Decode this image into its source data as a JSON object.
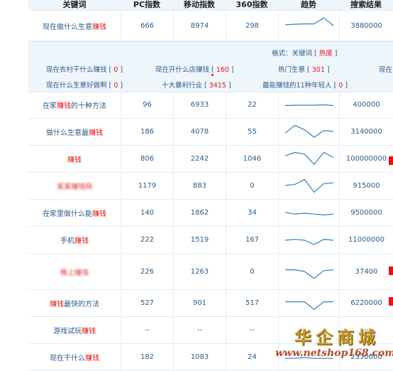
{
  "header": {
    "keyword": "关键词",
    "pc": "PC指数",
    "mobile": "移动指数",
    "s360": "360指数",
    "trend": "趋势",
    "results": "搜索结果"
  },
  "top_row": {
    "kw_pre": "现在做什么生意",
    "kw_hl": "赚钱",
    "kw_post": "",
    "pc": "666",
    "mobile": "8974",
    "s360": "298",
    "results": "3880000"
  },
  "related": {
    "format_label": "格式：关键词 [ ",
    "format_hot": "热度",
    "format_end": " ]",
    "items": [
      {
        "text": "现在农村干什么赚钱 [ ",
        "num": "0",
        "end": " ]"
      },
      {
        "text": "现在开什么店赚钱 [ ",
        "num": "160",
        "end": " ]"
      },
      {
        "text": "热门生意 [ ",
        "num": "301",
        "end": " ]"
      },
      {
        "text": "现在",
        "num": "",
        "end": ""
      },
      {
        "text": "现在什么生意好做啊 [ ",
        "num": "0",
        "end": " ]"
      },
      {
        "text": "十大暴利行业 [ ",
        "num": "3415",
        "end": " ]"
      },
      {
        "text": "最能赚钱的11种年轻人 [ ",
        "num": "0",
        "end": " ]"
      }
    ]
  },
  "rows": [
    {
      "pre": "在家",
      "hl": "赚钱",
      "post": "的十种方法",
      "pc": "96",
      "mobile": "6933",
      "s360": "22",
      "results": "400000"
    },
    {
      "pre": "做什么生意最",
      "hl": "赚钱",
      "post": "",
      "pc": "186",
      "mobile": "4078",
      "s360": "55",
      "results": "3140000"
    },
    {
      "pre": "",
      "hl": "赚钱",
      "post": "",
      "pc": "806",
      "mobile": "2242",
      "s360": "1046",
      "results": "100000000"
    },
    {
      "pre": "",
      "hl": "",
      "post": "",
      "blur": "某某赚钱网",
      "pc": "1179",
      "mobile": "883",
      "s360": "0",
      "results": "915000"
    },
    {
      "pre": "在家里做什么能",
      "hl": "赚钱",
      "post": "",
      "pc": "140",
      "mobile": "1862",
      "s360": "34",
      "results": "9500000"
    },
    {
      "pre": "手机",
      "hl": "赚钱",
      "post": "",
      "pc": "222",
      "mobile": "1519",
      "s360": "167",
      "results": "11000000"
    },
    {
      "pre": "",
      "hl": "",
      "post": "",
      "blur": "晚上赚钱",
      "pc": "226",
      "mobile": "1263",
      "s360": "0",
      "results": "37400"
    },
    {
      "pre": "",
      "hl": "赚钱",
      "post": "最快的方法",
      "pc": "527",
      "mobile": "901",
      "s360": "517",
      "results": "6220000"
    },
    {
      "pre": "游戏试玩",
      "hl": "赚钱",
      "post": "",
      "pc": "--",
      "mobile": "--",
      "s360": "--",
      "results": "--"
    },
    {
      "pre": "现在干什么",
      "hl": "赚钱",
      "post": "",
      "pc": "182",
      "mobile": "1083",
      "s360": "24",
      "results": "2330000"
    }
  ],
  "trends": [
    [
      0.45,
      0.42,
      0.4,
      0.4,
      0.05,
      0.5
    ],
    [
      0.52,
      0.5,
      0.5,
      0.5,
      0.48,
      0.52
    ],
    [
      0.55,
      0.1,
      0.35,
      0.8,
      0.4,
      0.45
    ],
    [
      0.3,
      0.1,
      0.2,
      0.8,
      0.1,
      0.4
    ],
    [
      0.45,
      0.4,
      0.1,
      0.85,
      0.35,
      0.3
    ],
    [
      0.45,
      0.55,
      0.5,
      0.55,
      0.6,
      0.55
    ],
    [
      0.5,
      0.45,
      0.5,
      0.75,
      0.45,
      0.5
    ],
    [
      0.4,
      0.4,
      0.5,
      0.9,
      0.45,
      0.4
    ],
    [
      0.4,
      0.4,
      0.4,
      0.85,
      0.4,
      0.4
    ],
    [],
    [
      0.55,
      0.55,
      0.5,
      0.55,
      0.55,
      0.55
    ]
  ],
  "watermark": {
    "cn": "华企商城",
    "url": "www.netshop168.com"
  }
}
